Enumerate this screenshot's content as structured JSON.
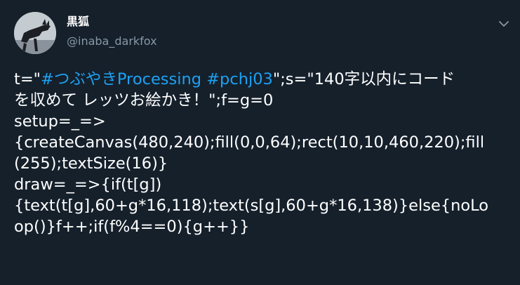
{
  "tweet": {
    "author_name": "黒狐",
    "handle": "@inaba_darkfox",
    "menu_icon": "chevron-down-icon",
    "avatar_icon": "avatar-image",
    "lines": [
      {
        "segments": [
          {
            "text": "t=\"",
            "link": false
          },
          {
            "text": "#つぶやきProcessing",
            "link": true
          },
          {
            "text": " ",
            "link": false
          },
          {
            "text": "#pchj03",
            "link": true
          },
          {
            "text": "\";s=\"140字以内にコード",
            "link": false
          }
        ]
      },
      {
        "segments": [
          {
            "text": "を収めて レッツお絵かき！\";f=g=0",
            "link": false
          }
        ]
      },
      {
        "segments": [
          {
            "text": "setup=_=>",
            "link": false
          }
        ]
      },
      {
        "segments": [
          {
            "text": "{createCanvas(480,240);fill(0,0,64);rect(10,10,460,220);fill",
            "link": false
          }
        ]
      },
      {
        "segments": [
          {
            "text": "(255);textSize(16)}",
            "link": false
          }
        ]
      },
      {
        "segments": [
          {
            "text": "draw=_=>{if(t[g])",
            "link": false
          }
        ]
      },
      {
        "segments": [
          {
            "text": "{text(t[g],60+g*16,118);text(s[g],60+g*16,138)}else{noLo",
            "link": false
          }
        ]
      },
      {
        "segments": [
          {
            "text": "op()}f++;if(f%4==0){g++}}",
            "link": false
          }
        ]
      }
    ]
  },
  "colors": {
    "background": "#15202b",
    "text": "#ffffff",
    "secondary_text": "#8899a6",
    "link": "#1da1f2"
  }
}
